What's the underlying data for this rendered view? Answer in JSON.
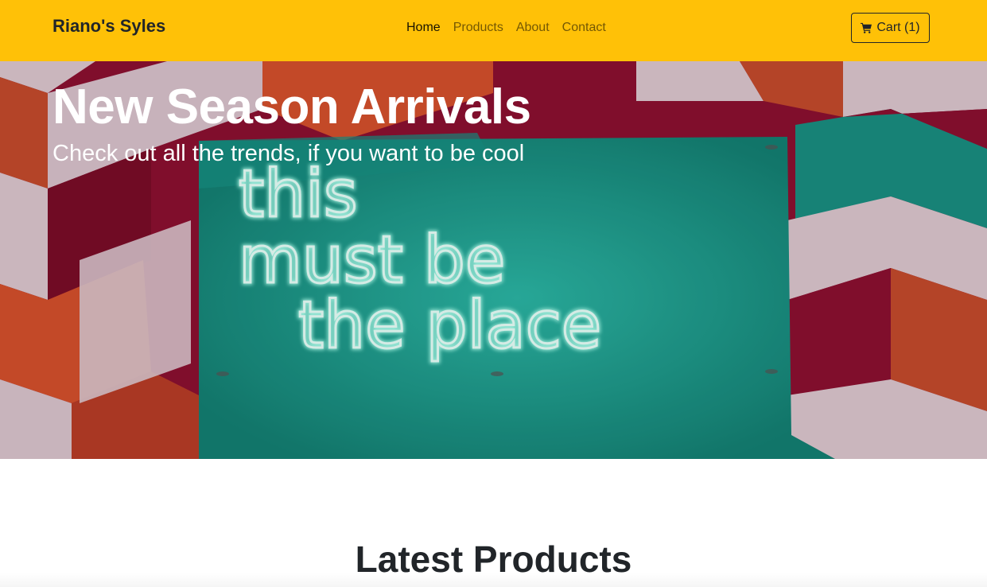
{
  "navbar": {
    "brand": "Riano's Syles",
    "links": [
      {
        "label": "Home",
        "active": true
      },
      {
        "label": "Products",
        "active": false
      },
      {
        "label": "About",
        "active": false
      },
      {
        "label": "Contact",
        "active": false
      }
    ],
    "cart_label": "Cart (1)",
    "cart_icon": "shopping-cart-icon",
    "background_color": "#ffc107"
  },
  "hero": {
    "title": "New Season Arrivals",
    "subtitle": "Check out all the trends, if you want to be cool",
    "image_neon_text": [
      "this",
      "must be",
      "the place"
    ],
    "colors": {
      "teal": "#1f9e8e",
      "red": "#8b1030",
      "orange": "#d4502c",
      "pink": "#dcc6ce"
    }
  },
  "products_section": {
    "title": "Latest Products"
  }
}
